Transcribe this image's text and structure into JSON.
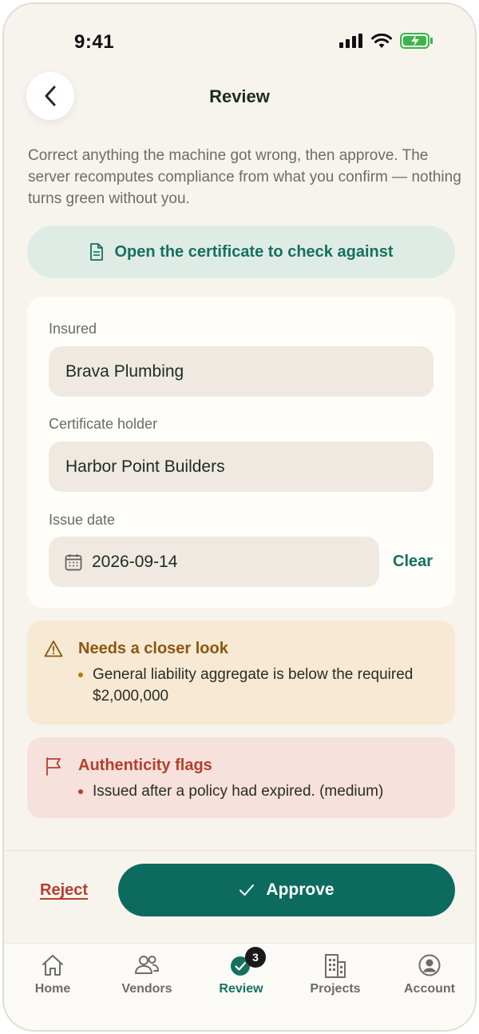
{
  "status_bar": {
    "time": "9:41"
  },
  "header": {
    "title": "Review"
  },
  "intro": "Correct anything the machine got wrong, then approve. The server recomputes compliance from what you confirm — nothing turns green without you.",
  "open_certificate_label": "Open the certificate to check against",
  "form": {
    "insured_label": "Insured",
    "insured_value": "Brava Plumbing",
    "holder_label": "Certificate holder",
    "holder_value": "Harbor Point Builders",
    "issue_date_label": "Issue date",
    "issue_date_value": "2026-09-14",
    "clear_label": "Clear"
  },
  "closer_look": {
    "title": "Needs a closer look",
    "items": [
      "General liability aggregate is below the required $2,000,000"
    ]
  },
  "authenticity": {
    "title": "Authenticity flags",
    "items": [
      "Issued after a policy had expired. (medium)"
    ]
  },
  "actions": {
    "reject_label": "Reject",
    "approve_label": "Approve"
  },
  "tabs": [
    {
      "label": "Home",
      "icon": "home-icon"
    },
    {
      "label": "Vendors",
      "icon": "users-icon"
    },
    {
      "label": "Review",
      "icon": "review-check-icon",
      "badge": "3",
      "active": true
    },
    {
      "label": "Projects",
      "icon": "building-icon"
    },
    {
      "label": "Account",
      "icon": "account-icon"
    }
  ],
  "colors": {
    "accent": "#0c6b5e",
    "accent_text": "#16705f",
    "warning": "#8c5712",
    "danger": "#b63f2d",
    "background": "#f7f4ee"
  }
}
